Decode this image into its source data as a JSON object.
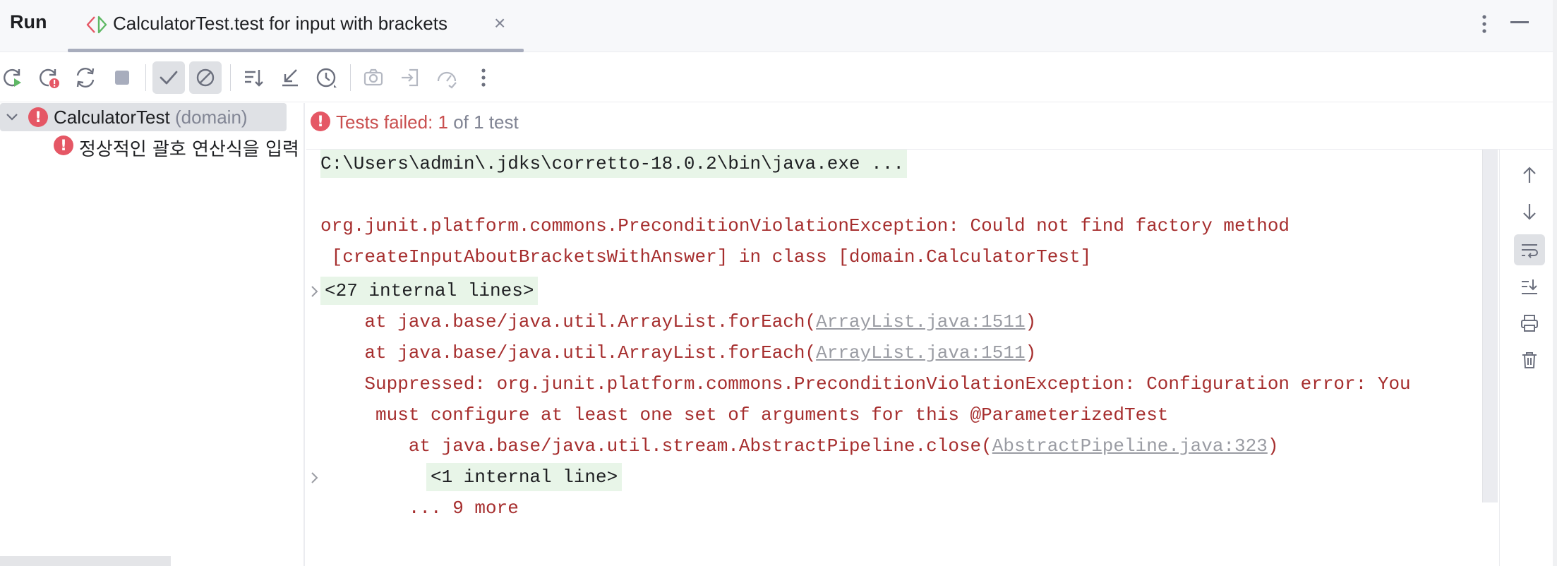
{
  "header": {
    "run_label": "Run",
    "tab_title": "CalculatorTest.test for input with brackets",
    "tab_close": "×"
  },
  "toolbar": {
    "buttons": [
      "rerun-icon",
      "rerun-failed-icon",
      "toggle-auto-test-icon",
      "stop-icon",
      "show-passed-icon",
      "show-ignored-icon",
      "sort-alphabetically-icon",
      "sort-by-duration-icon",
      "test-history-icon",
      "export-screenshot-icon",
      "import-tests-icon",
      "coverage-icon",
      "more-icon"
    ]
  },
  "tree": {
    "root_label": "CalculatorTest",
    "root_suffix": "(domain)",
    "child_label": "정상적인 괄호 연산식을 입력"
  },
  "status": {
    "fail_text": "Tests failed: 1",
    "rest_text": " of 1 test"
  },
  "console": {
    "cmd": "C:\\Users\\admin\\.jdks\\corretto-18.0.2\\bin\\java.exe ...",
    "line1": "org.junit.platform.commons.PreconditionViolationException: Could not find factory method",
    "line2": " [createInputAboutBracketsWithAnswer] in class [domain.CalculatorTest]",
    "internal1": "<27 internal lines>",
    "at1_prefix": "    at java.base/java.util.ArrayList.forEach(",
    "at1_link": "ArrayList.java:1511",
    "at1_suffix": ")",
    "at2_prefix": "    at java.base/java.util.ArrayList.forEach(",
    "at2_link": "ArrayList.java:1511",
    "at2_suffix": ")",
    "suppressed1": "    Suppressed: org.junit.platform.commons.PreconditionViolationException: Configuration error: You",
    "suppressed2": "     must configure at least one set of arguments for this @ParameterizedTest",
    "at3_prefix": "        at java.base/java.util.stream.AbstractPipeline.close(",
    "at3_link": "AbstractPipeline.java:323",
    "at3_suffix": ")",
    "internal2": "<1 internal line>",
    "more": "        ... 9 more"
  },
  "side_tools": [
    "scroll-up-icon",
    "scroll-down-icon",
    "soft-wrap-icon",
    "scroll-to-end-icon",
    "print-icon",
    "clear-icon"
  ],
  "colors": {
    "error": "#e55765",
    "fail_text": "#c94f4f",
    "console_error": "#a62e2e",
    "internal_bg": "#e8f5e8",
    "selection": "#dfe1e5"
  }
}
